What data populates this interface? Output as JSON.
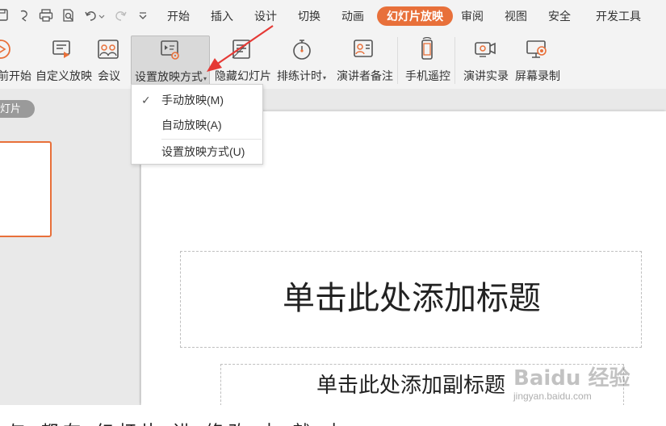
{
  "colors": {
    "accent": "#e8703a",
    "arrow": "#e53935"
  },
  "menubar": {
    "quick_access_icons": [
      "save-icon",
      "undo-history-icon",
      "print-icon",
      "print-preview-icon",
      "undo-icon",
      "redo-icon",
      "customize-dropdown-icon"
    ],
    "tabs": [
      "开始",
      "插入",
      "设计",
      "切换",
      "动画",
      "幻灯片放映",
      "审阅",
      "视图",
      "安全",
      "开发工具"
    ],
    "active_tab": "幻灯片放映"
  },
  "ribbon": {
    "buttons": [
      {
        "label": "前开始",
        "icon": "play-from-current-icon"
      },
      {
        "label": "自定义放映",
        "icon": "custom-show-icon"
      },
      {
        "label": "会议",
        "icon": "meeting-icon"
      },
      {
        "label": "设置放映方式",
        "icon": "setup-show-icon",
        "has_dropdown": true
      },
      {
        "label": "隐藏幻灯片",
        "icon": "hide-slide-icon"
      },
      {
        "label": "排练计时",
        "icon": "rehearse-timings-icon",
        "has_dropdown": true
      },
      {
        "label": "演讲者备注",
        "icon": "speaker-notes-icon"
      },
      {
        "label": "手机遥控",
        "icon": "phone-remote-icon"
      },
      {
        "label": "演讲实录",
        "icon": "record-presentation-icon"
      },
      {
        "label": "屏幕录制",
        "icon": "screen-record-icon"
      }
    ]
  },
  "dropdown": {
    "items": [
      {
        "label": "手动放映(M)",
        "checked": true
      },
      {
        "label": "自动放映(A)",
        "checked": false
      },
      {
        "label": "设置放映方式(U)",
        "checked": false
      }
    ]
  },
  "slide_panel": {
    "tag": "幻灯片"
  },
  "slide": {
    "title_placeholder": "单击此处添加标题",
    "subtitle_placeholder": "单击此处添加副标题"
  },
  "caption": "与 都在 幻灯片 进 修改 中 就 中",
  "watermark": {
    "logo": "Baidu 经验",
    "url": "jingyan.baidu.com"
  }
}
